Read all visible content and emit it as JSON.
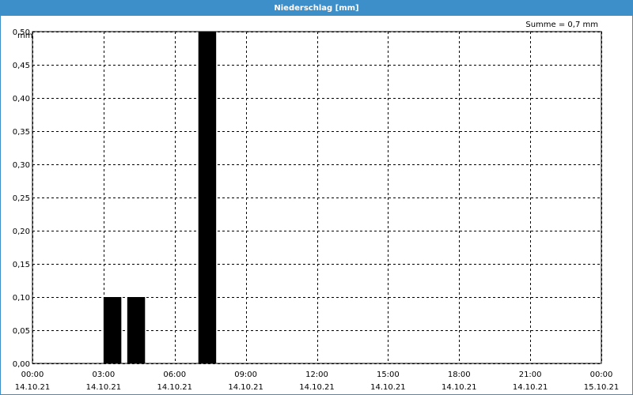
{
  "window": {
    "title": "Niederschlag [mm]"
  },
  "chart_data": {
    "type": "bar",
    "title": "Niederschlag [mm]",
    "unit_label": "mm",
    "sum_label": "Summe = 0,7 mm",
    "ylim": [
      0,
      0.5
    ],
    "y_ticks": [
      "0,00",
      "0,05",
      "0,10",
      "0,15",
      "0,20",
      "0,25",
      "0,30",
      "0,35",
      "0,40",
      "0,45",
      "0,50"
    ],
    "x_ticks": [
      {
        "time": "00:00",
        "date": "14.10.21"
      },
      {
        "time": "03:00",
        "date": "14.10.21"
      },
      {
        "time": "06:00",
        "date": "14.10.21"
      },
      {
        "time": "09:00",
        "date": "14.10.21"
      },
      {
        "time": "12:00",
        "date": "14.10.21"
      },
      {
        "time": "15:00",
        "date": "14.10.21"
      },
      {
        "time": "18:00",
        "date": "14.10.21"
      },
      {
        "time": "21:00",
        "date": "14.10.21"
      },
      {
        "time": "00:00",
        "date": "15.10.21"
      }
    ],
    "x_range_hours": [
      0,
      24
    ],
    "grid": true,
    "bars": [
      {
        "start": "03:00",
        "end": "03:45",
        "value": 0.1
      },
      {
        "start": "04:00",
        "end": "04:45",
        "value": 0.1
      },
      {
        "start": "07:00",
        "end": "07:45",
        "value": 0.5
      }
    ],
    "bar_color": "#000000"
  },
  "colors": {
    "title_bar": "#3c8fc9",
    "grid": "#000000"
  }
}
